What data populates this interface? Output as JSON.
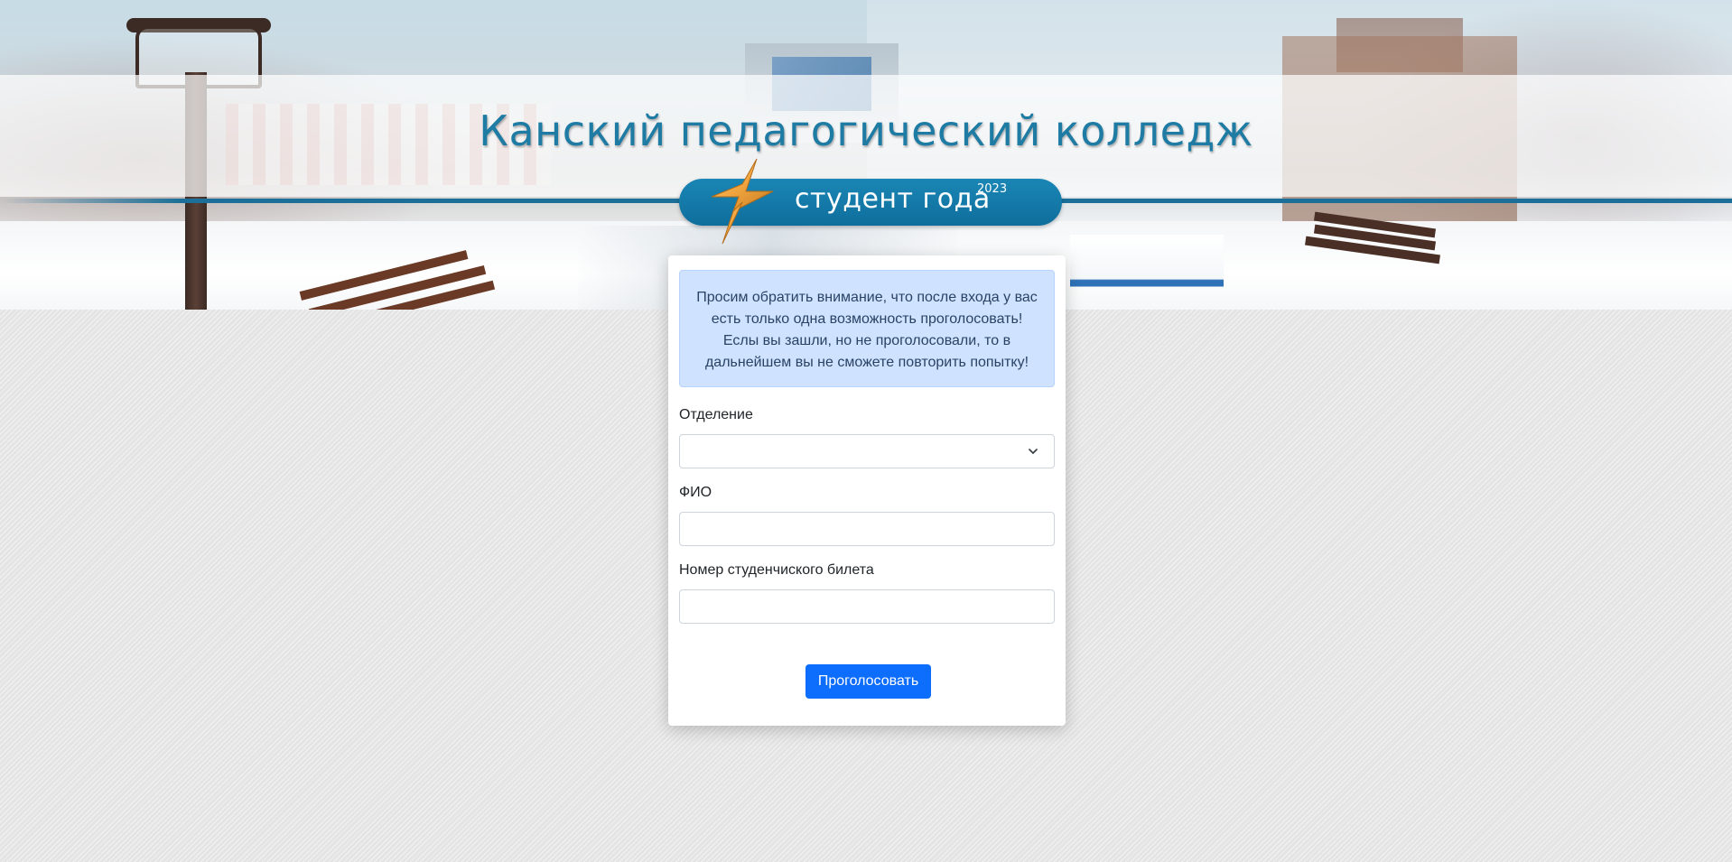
{
  "header": {
    "title": "Канский педагогический колледж",
    "badge_text": "студент года",
    "badge_year": "2023",
    "logo_icon": "lightning-star-icon"
  },
  "notice": {
    "lines": [
      "Просим обратить внимание, что после входа у вас",
      "есть только одна возможность проголосовать!",
      "Еслы вы зашли, но не проголосовали, то в",
      "дальнейшем вы не сможете повторить попытку!"
    ]
  },
  "form": {
    "department_label": "Отделение",
    "department_value": "",
    "fio_label": "ФИО",
    "fio_value": "",
    "ticket_label": "Номер студенчиского билета",
    "ticket_value": "",
    "submit_label": "Проголосовать"
  },
  "colors": {
    "title": "#1e7ba4",
    "badge": "#1a86b5",
    "alert_bg": "#cfe2ff",
    "button": "#0d6efd"
  }
}
